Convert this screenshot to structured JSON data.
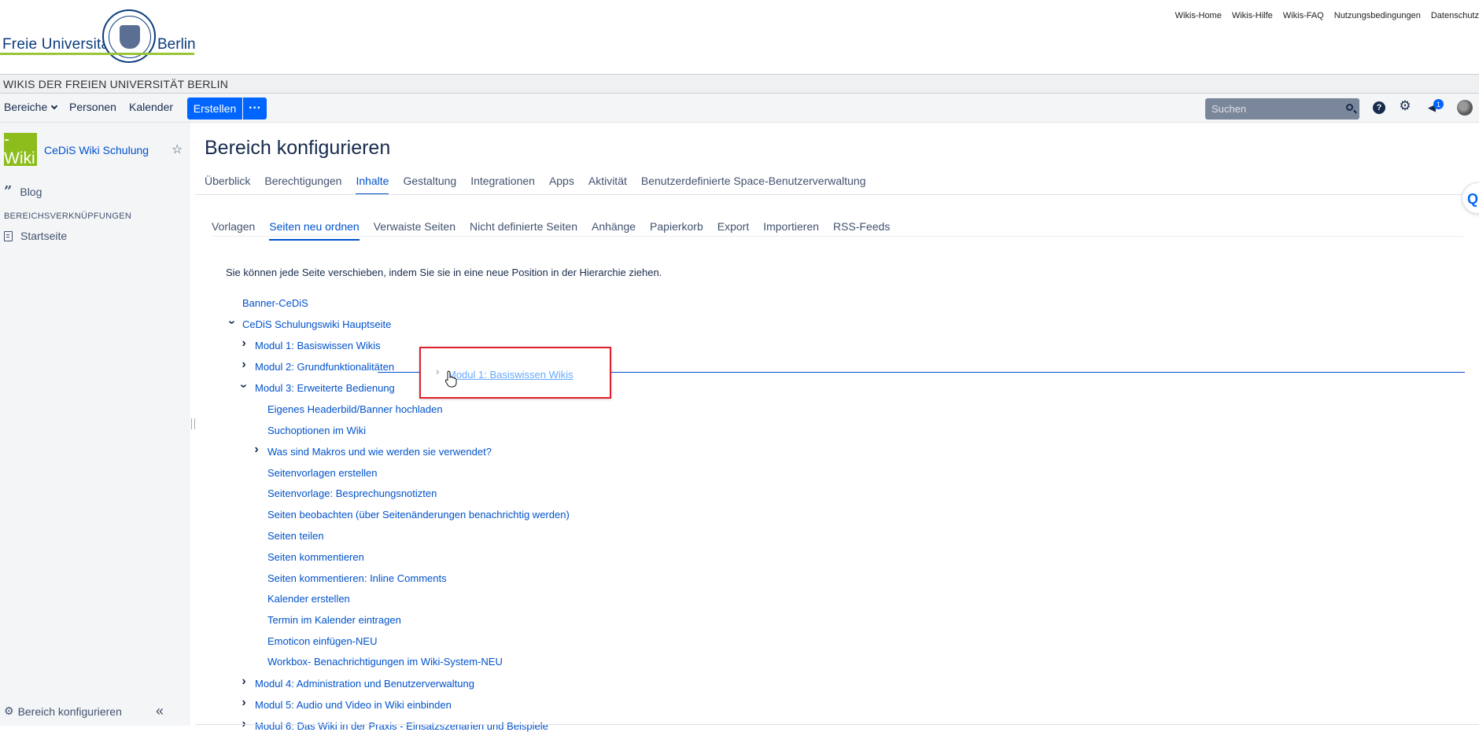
{
  "university": {
    "name_left": "Freie Universität",
    "name_right": "Berlin",
    "top_links": [
      "Wikis-Home",
      "Wikis-Hilfe",
      "Wikis-FAQ",
      "Nutzungsbedingungen",
      "Datenschutz"
    ]
  },
  "wiki_strip": "WIKIS DER FREIEN UNIVERSITÄT BERLIN",
  "navbar": {
    "bereiche": "Bereiche",
    "personen": "Personen",
    "kalender": "Kalender",
    "create": "Erstellen",
    "more": "···",
    "search_placeholder": "Suchen",
    "notification_count": "1"
  },
  "sidebar": {
    "space_logo": "-Wiki",
    "space_name": "CeDiS Wiki Schulung",
    "blog": "Blog",
    "shortcuts_heading": "BEREICHSVERKNÜPFUNGEN",
    "start_page": "Startseite",
    "configure": "Bereich konfigurieren"
  },
  "main": {
    "title": "Bereich konfigurieren",
    "tabs": [
      "Überblick",
      "Berechtigungen",
      "Inhalte",
      "Gestaltung",
      "Integrationen",
      "Apps",
      "Aktivität",
      "Benutzerdefinierte Space-Benutzerverwaltung"
    ],
    "active_tab": "Inhalte",
    "subtabs": [
      "Vorlagen",
      "Seiten neu ordnen",
      "Verwaiste Seiten",
      "Nicht definierte Seiten",
      "Anhänge",
      "Papierkorb",
      "Export",
      "Importieren",
      "RSS-Feeds"
    ],
    "active_subtab": "Seiten neu ordnen",
    "intro": "Sie können jede Seite verschieben, indem Sie sie in eine neue Position in der Hierarchie ziehen."
  },
  "tree": [
    {
      "label": "Banner-CeDiS",
      "level": 0,
      "chevron": "none"
    },
    {
      "label": "CeDiS Schulungswiki Hauptseite",
      "level": 0,
      "chevron": "down"
    },
    {
      "label": "Modul 1: Basiswissen Wikis",
      "level": 1,
      "chevron": "right"
    },
    {
      "label": "Modul 2: Grundfunktionalitäten",
      "level": 1,
      "chevron": "right"
    },
    {
      "label": "Modul 3: Erweiterte Bedienung",
      "level": 1,
      "chevron": "down"
    },
    {
      "label": "Eigenes Headerbild/Banner hochladen",
      "level": 2,
      "chevron": "none"
    },
    {
      "label": "Suchoptionen im Wiki",
      "level": 2,
      "chevron": "none"
    },
    {
      "label": "Was sind Makros und wie werden sie verwendet?",
      "level": 2,
      "chevron": "right"
    },
    {
      "label": "Seitenvorlagen erstellen",
      "level": 2,
      "chevron": "none"
    },
    {
      "label": "Seitenvorlage: Besprechungsnotizten",
      "level": 2,
      "chevron": "none"
    },
    {
      "label": "Seiten beobachten (über Seitenänderungen benachrichtig werden)",
      "level": 2,
      "chevron": "none"
    },
    {
      "label": "Seiten teilen",
      "level": 2,
      "chevron": "none"
    },
    {
      "label": "Seiten kommentieren",
      "level": 2,
      "chevron": "none"
    },
    {
      "label": "Seiten kommentieren: Inline Comments",
      "level": 2,
      "chevron": "none"
    },
    {
      "label": "Kalender erstellen",
      "level": 2,
      "chevron": "none"
    },
    {
      "label": "Termin im Kalender eintragen",
      "level": 2,
      "chevron": "none"
    },
    {
      "label": "Emoticon einfügen-NEU",
      "level": 2,
      "chevron": "none"
    },
    {
      "label": "Workbox- Benachrichtigungen im Wiki-System-NEU",
      "level": 2,
      "chevron": "none"
    },
    {
      "label": "Modul 4: Administration und Benutzerverwaltung",
      "level": 1,
      "chevron": "right"
    },
    {
      "label": "Modul 5: Audio und Video in Wiki einbinden",
      "level": 1,
      "chevron": "right"
    },
    {
      "label": "Modul 6: Das Wiki in der Praxis - Einsatzszenarien und Beispiele",
      "level": 1,
      "chevron": "right"
    }
  ],
  "drag_ghost": {
    "label": "Modul 1: Basiswissen Wikis"
  },
  "colors": {
    "accent": "#0065ff",
    "link": "#0052cc",
    "highlight_box": "#e0202a",
    "space_logo": "#8cbd1c"
  }
}
